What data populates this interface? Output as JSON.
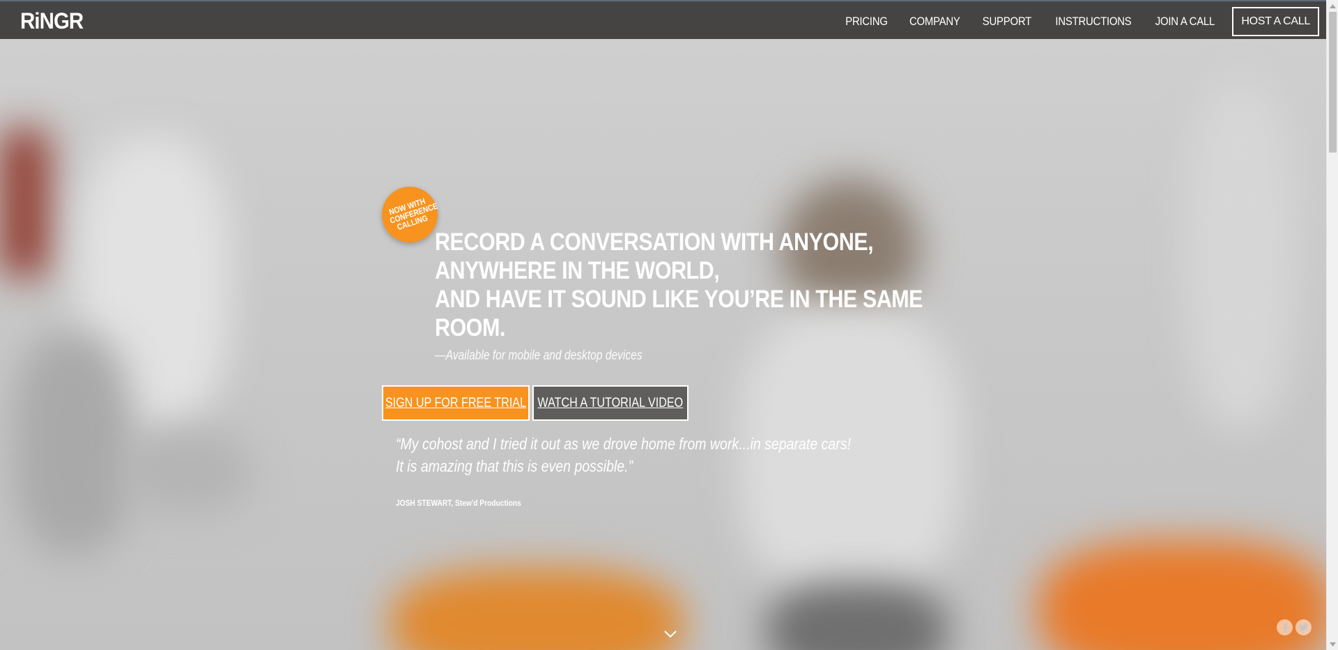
{
  "brand": {
    "logo_text": "RiNGR"
  },
  "nav": {
    "items": [
      {
        "label": "PRICING"
      },
      {
        "label": "COMPANY"
      },
      {
        "label": "SUPPORT"
      },
      {
        "label": "INSTRUCTIONS"
      },
      {
        "label": "JOIN A CALL"
      }
    ],
    "host_label": "HOST A CALL"
  },
  "hero": {
    "badge": "NOW WITH\nCONFERENCE\nCALLING",
    "headline": [
      "RECORD A CONVERSATION WITH ANYONE,",
      "ANYWHERE IN THE WORLD,",
      "AND HAVE IT SOUND LIKE YOU’RE IN THE SAME",
      "ROOM."
    ],
    "subline": "—Available for mobile and desktop devices",
    "signup_label": "SIGN UP FOR FREE TRIAL",
    "video_label": "WATCH A TUTORIAL VIDEO",
    "quote": "“My cohost and I tried it out as we drove home from work...in separate cars! It is amazing that this is even possible.”",
    "author": "JOSH STEWART, Stew'd Productions"
  },
  "icons": {
    "scroll_down": "chevron-down-icon",
    "facebook": "facebook-icon",
    "twitter": "twitter-icon"
  },
  "colors": {
    "nav_bg": "#454442",
    "accent_orange": "#f7931e",
    "secondary_button": "#5f5e5c"
  }
}
